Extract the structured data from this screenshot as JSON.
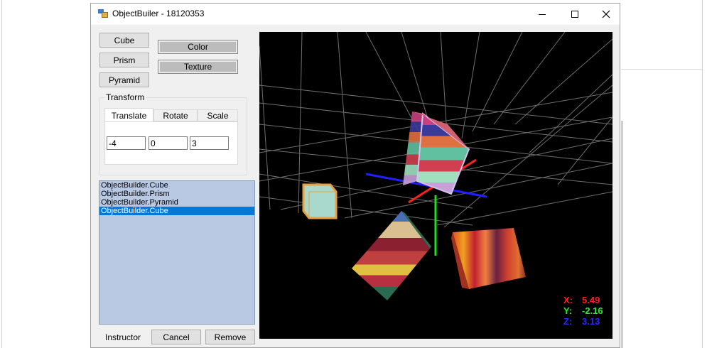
{
  "window": {
    "title": "ObjectBuiler - 18120353"
  },
  "buttons": {
    "cube": "Cube",
    "prism": "Prism",
    "pyramid": "Pyramid",
    "color": "Color",
    "texture": "Texture",
    "cancel": "Cancel",
    "remove": "Remove"
  },
  "transform": {
    "title": "Transform",
    "tabs": [
      "Translate",
      "Rotate",
      "Scale"
    ],
    "active_tab": "Translate",
    "values": [
      "-4",
      "0",
      "3"
    ]
  },
  "object_list": {
    "items": [
      "ObjectBuilder.Cube",
      "ObjectBuilder.Prism",
      "ObjectBuilder.Pyramid",
      "ObjectBuilder.Cube"
    ],
    "selected_index": 3
  },
  "footer": {
    "instructor_label": "Instructor"
  },
  "viewport": {
    "background": "#000000",
    "coords": {
      "x_label": "X:",
      "x_value": "5.49",
      "y_label": "Y:",
      "y_value": "-2.16",
      "z_label": "Z:",
      "z_value": "3.13"
    },
    "colors": {
      "x": "#ff2020",
      "y": "#2ee82e",
      "z": "#2a2aff"
    }
  }
}
